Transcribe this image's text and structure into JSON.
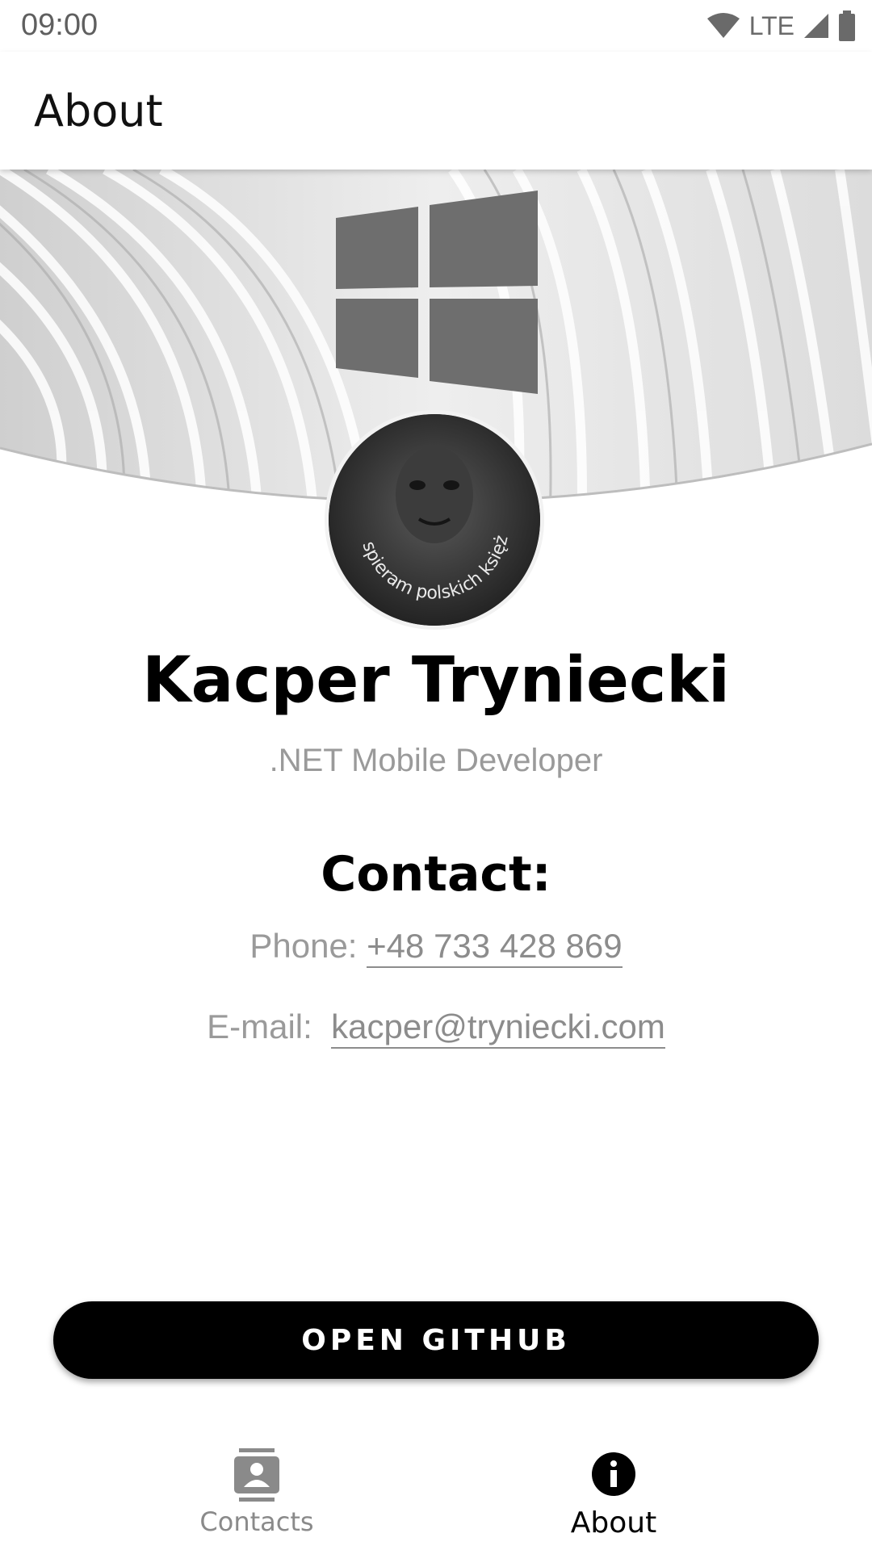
{
  "status_bar": {
    "time": "09:00",
    "network": "LTE"
  },
  "app_bar": {
    "title": "About"
  },
  "profile": {
    "name": "Kacper Tryniecki",
    "role": ".NET Mobile Developer",
    "avatar_caption": "Wspieram polskich księży"
  },
  "contact": {
    "heading": "Contact:",
    "phone_label": "Phone:",
    "phone_value": "+48 733 428 869",
    "email_label": "E-mail:",
    "email_value": "kacper@tryniecki.com"
  },
  "button": {
    "label": "OPEN GITHUB"
  },
  "bottom_nav": {
    "items": [
      {
        "label": "Contacts",
        "icon": "contacts-icon",
        "active": false
      },
      {
        "label": "About",
        "icon": "info-icon",
        "active": true
      }
    ]
  },
  "colors": {
    "accent": "#000000",
    "muted": "#9a9a9a"
  }
}
